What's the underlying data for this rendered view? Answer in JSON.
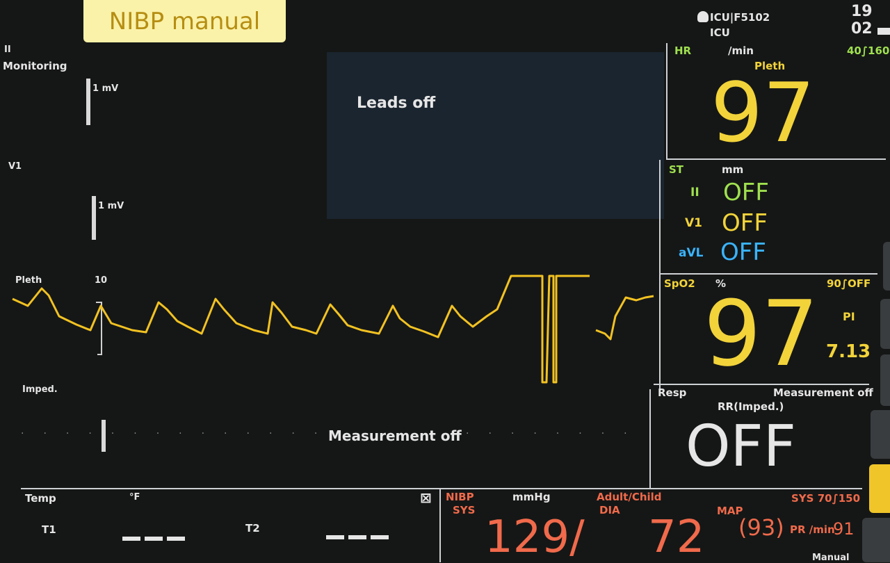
{
  "header": {
    "nibp_banner": "NIBP manual",
    "location_line1": "ICU|F5102",
    "location_line2": "ICU",
    "time": "19 02"
  },
  "waveforms": {
    "lead1_label": "II",
    "lead1_sub": "Monitoring",
    "lead1_scale": "1 mV",
    "lead2_label": "V1",
    "lead2_scale": "1 mV",
    "leads_off": "Leads off",
    "pleth_label": "Pleth",
    "pleth_scale": "10",
    "imped_label": "Imped.",
    "imped_status": "Measurement off"
  },
  "hr": {
    "label": "HR",
    "unit": "/min",
    "limits": "40∫160",
    "source": "Pleth",
    "value": "97"
  },
  "st": {
    "label": "ST",
    "unit": "mm",
    "rows": [
      {
        "lead": "II",
        "value": "OFF"
      },
      {
        "lead": "V1",
        "value": "OFF"
      },
      {
        "lead": "aVL",
        "value": "OFF"
      }
    ]
  },
  "spo2": {
    "label": "SpO2",
    "unit": "%",
    "limits": "90∫OFF",
    "value": "97",
    "pi_label": "PI",
    "pi_value": "7.13"
  },
  "resp": {
    "label": "Resp",
    "status": "Measurement off",
    "source": "RR(Imped.)",
    "value": "OFF"
  },
  "temp": {
    "label": "Temp",
    "unit": "°F",
    "t1": "T1",
    "t2": "T2"
  },
  "nibp": {
    "label": "NIBP",
    "sys_label": "SYS",
    "unit": "mmHg",
    "mode": "Adult/Child",
    "dia_label": "DIA",
    "map_label": "MAP",
    "limits": "SYS 70∫150",
    "sys_value": "129/",
    "dia_value": "72",
    "map_value": "(93)",
    "pr_label": "PR /min",
    "pr_value": "91",
    "cycle": "Manual"
  },
  "colors": {
    "hr": "#f2d33a",
    "st_ii": "#9fe04f",
    "st_v1": "#f2d33a",
    "st_avl": "#3ab4ff",
    "nibp": "#f06a4b"
  }
}
